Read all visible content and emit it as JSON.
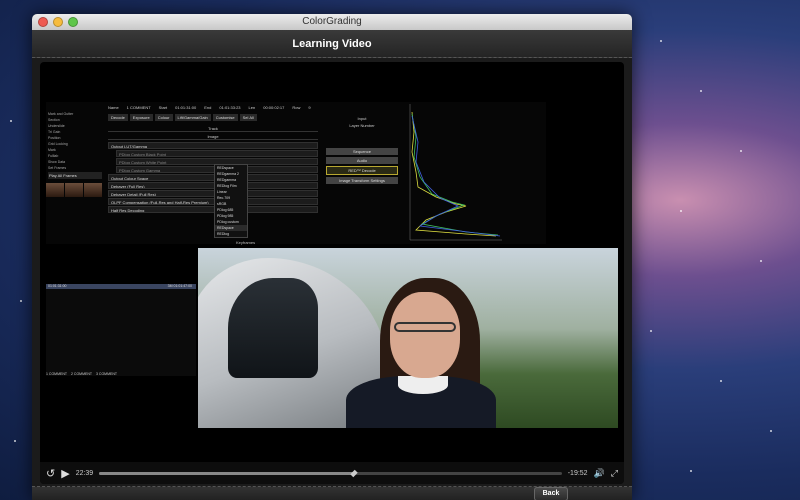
{
  "window": {
    "title": "ColorGrading"
  },
  "header": {
    "title": "Learning Video"
  },
  "recording": {
    "toolbar": [
      "Name",
      "1 COMMENT",
      "Start",
      "01:01:31:00",
      "End",
      "01:01:33:23",
      "Len",
      "00:00:02:17",
      "Row",
      "9"
    ],
    "tabs": [
      "Decode",
      "Exposure",
      "Colour",
      "Lift/Gamma/Gain",
      "Customise",
      "Sel All"
    ],
    "left_lines": [
      "Mark and Gutter",
      "Section",
      "Underslide",
      "Tri Gain",
      "Position",
      "Grid Locking",
      "Mark",
      "Fulllab",
      "Show Data",
      "Set Frames"
    ],
    "play_all_frames": "Play All Frames",
    "sections": [
      "Track",
      "Image"
    ],
    "rows": [
      {
        "label": "Output LUT/Gamma",
        "sub": false
      },
      {
        "label": "PDlog Custom Black Point",
        "sub": true
      },
      {
        "label": "PDlog Custom White Point",
        "sub": true
      },
      {
        "label": "PDlog Custom Gamma",
        "sub": true
      },
      {
        "label": "Output Colour Space",
        "sub": false
      },
      {
        "label": "Debayer (Full Res)",
        "sub": false
      },
      {
        "label": "Debayer Detail (Full Res)",
        "sub": false
      },
      {
        "label": "OLPF Compensation (Full-Res and Half-Res Premium)",
        "sub": false
      },
      {
        "label": "Half Res Decoding",
        "sub": false
      }
    ],
    "dropdown_items": [
      "REDspace",
      "REDgamma 2",
      "REDgamma",
      "REDlog Film",
      "Linear",
      "Rec.709",
      "sRGB",
      "PDlog 685",
      "PDlog 985",
      "PDlog custom",
      "REDspace",
      "REDlog"
    ],
    "dropdown_selected_index": 10,
    "right_panel": {
      "input_label": "Input",
      "layer_number": "Layer Number",
      "buttons": [
        "Sequence",
        "Audio",
        "RED™ Decode",
        "Image Transform Settings"
      ],
      "highlighted_button_index": 2
    },
    "keyframes_label": "Keyframes",
    "timeline_bar": "01:01:31:00",
    "timeline_bar_right": "3M 01:01:47:00",
    "bottom_tabs": [
      "1 COMMENT",
      "2 COMMENT",
      "3 COMMENT"
    ]
  },
  "player": {
    "elapsed": "22:39",
    "remaining": "-19:52",
    "progress": 0.55,
    "icons": [
      "rewind-30-icon",
      "play-icon",
      "volume-icon",
      "fullscreen-icon"
    ]
  },
  "footer": {
    "back_label": "Back"
  }
}
